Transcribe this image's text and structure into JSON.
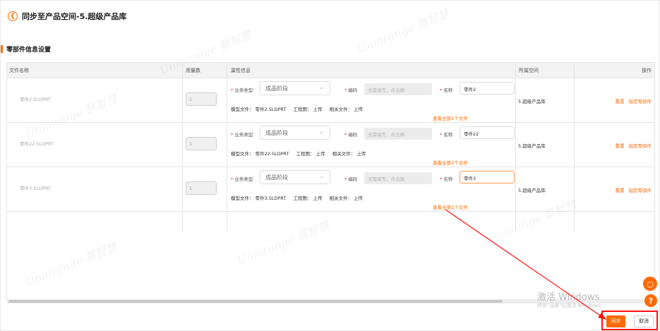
{
  "header": {
    "title": "同步至产品空间-5.超级产品库"
  },
  "section": {
    "title": "零部件信息设置"
  },
  "table": {
    "columns": [
      "文件名称",
      "用量数",
      "属性信息",
      "所属空间",
      "操作"
    ],
    "labels": {
      "business_type": "业务类型",
      "code": "编码",
      "name": "名称",
      "model_file": "模型文件：",
      "drawing": "工程图：",
      "related": "相关文件：",
      "view_all": "查看全部1个文件"
    },
    "rows": [
      {
        "file": "零件2.SLDPRT",
        "qty": "1",
        "business_type": "成品阶段",
        "code_placeholder": "无需填写，点击确",
        "name": "零件2",
        "model_file": "零件2.SLDPRT",
        "drawing": "上传",
        "related": "上传",
        "space": "5.超级产品库"
      },
      {
        "file": "零件22.SLDPRT",
        "qty": "1",
        "business_type": "成品阶段",
        "code_placeholder": "无需填写，点击确",
        "name": "零件22",
        "model_file": "零件22.SLDPRT",
        "drawing": "上传",
        "related": "上传",
        "space": "5.超级产品库"
      },
      {
        "file": "零件3.SLDPRT",
        "qty": "1",
        "business_type": "成品阶段",
        "code_placeholder": "无需填写，点击确",
        "name": "零件3",
        "model_file": "零件3.SLDPRT",
        "drawing": "上传",
        "related": "上传",
        "space": "5.超级产品库"
      }
    ],
    "actions": {
      "reset": "重置",
      "specify": "指定零部件"
    }
  },
  "watermark": {
    "brand": "Uniorange",
    "name": "蔡智慧"
  },
  "activation": {
    "title": "激活 Windows",
    "subtitle": "转到\"设置\"以激活 Windows。"
  },
  "footer": {
    "sync": "同步",
    "cancel": "取消"
  },
  "colors": {
    "accent": "#ff6a00",
    "highlight": "#ff1111"
  }
}
